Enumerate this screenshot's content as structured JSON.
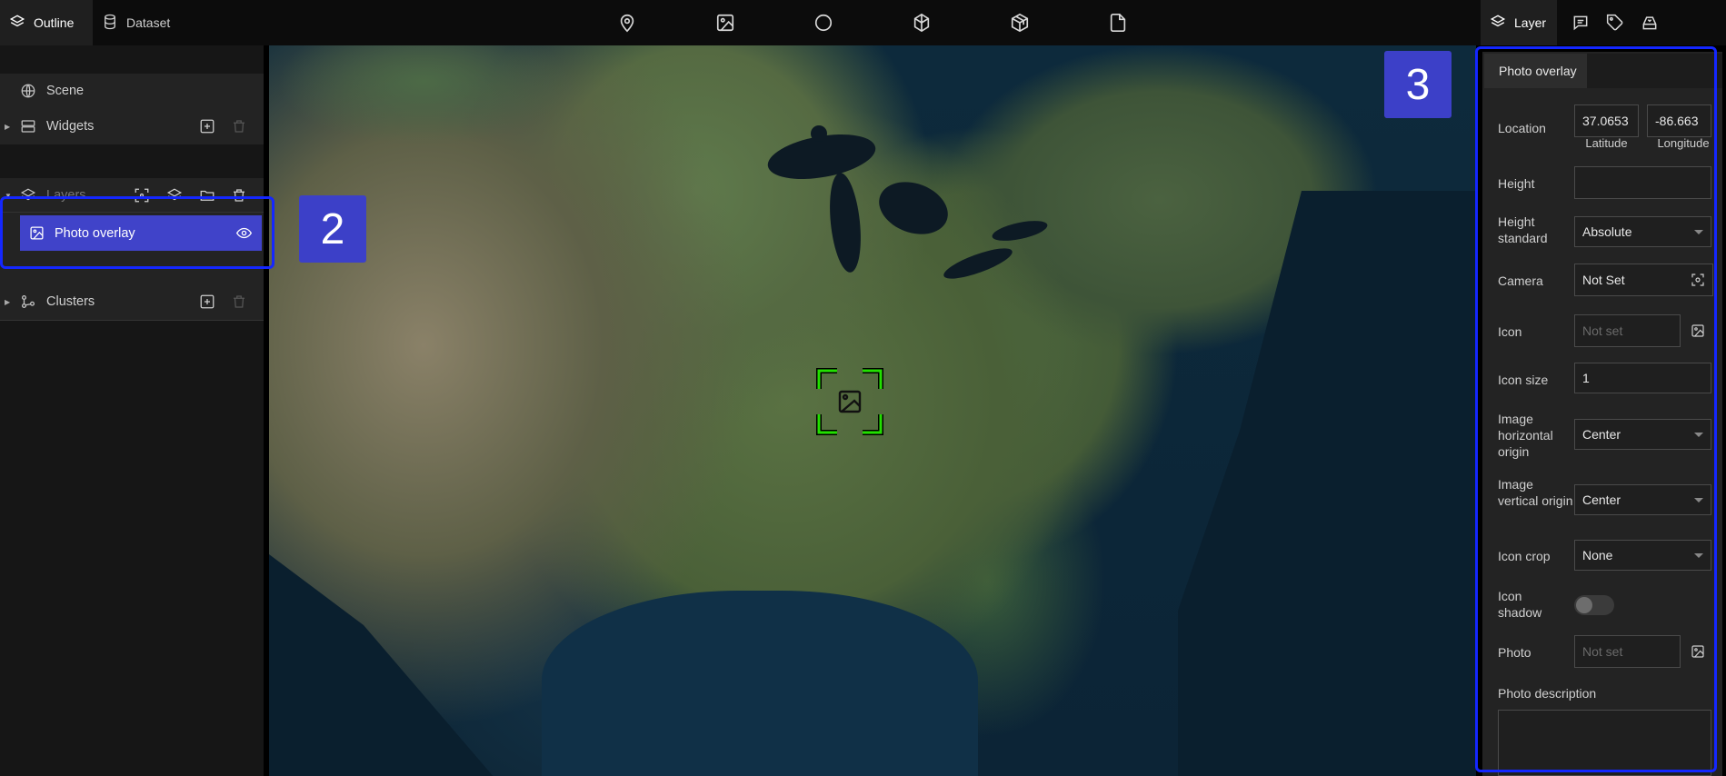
{
  "header": {
    "tabs": [
      {
        "label": "Outline",
        "icon": "layers-icon"
      },
      {
        "label": "Dataset",
        "icon": "database-icon"
      }
    ],
    "tools": [
      "marker-icon",
      "image-icon",
      "circle-icon",
      "polygon-icon",
      "model-icon",
      "file-icon"
    ],
    "right_tab": {
      "label": "Layer",
      "icon": "layers-icon"
    },
    "right_icons": [
      "comment-icon",
      "tag-icon",
      "story-icon"
    ]
  },
  "outline": {
    "scene": "Scene",
    "widgets": "Widgets",
    "layers": "Layers",
    "selected_layer": "Photo overlay",
    "clusters": "Clusters"
  },
  "annotations": {
    "left": "2",
    "right": "3"
  },
  "panel": {
    "tab": "Photo overlay",
    "location_label": "Location",
    "latitude_value": "37.0653",
    "longitude_value": "-86.663",
    "latitude_label": "Latitude",
    "longitude_label": "Longitude",
    "height_label": "Height",
    "height_value": "",
    "height_standard_label": "Height standard",
    "height_standard_value": "Absolute",
    "camera_label": "Camera",
    "camera_value": "Not Set",
    "icon_label": "Icon",
    "icon_placeholder": "Not set",
    "icon_size_label": "Icon size",
    "icon_size_value": "1",
    "h_origin_label": "Image horizontal origin",
    "h_origin_value": "Center",
    "v_origin_label": "Image vertical origin",
    "v_origin_value": "Center",
    "icon_crop_label": "Icon crop",
    "icon_crop_value": "None",
    "icon_shadow_label": "Icon shadow",
    "icon_shadow_on": false,
    "photo_label": "Photo",
    "photo_placeholder": "Not set",
    "photo_description_label": "Photo description"
  },
  "colors": {
    "accent": "#4043c9",
    "marker": "#22e000",
    "annotation": "#1427ff"
  }
}
